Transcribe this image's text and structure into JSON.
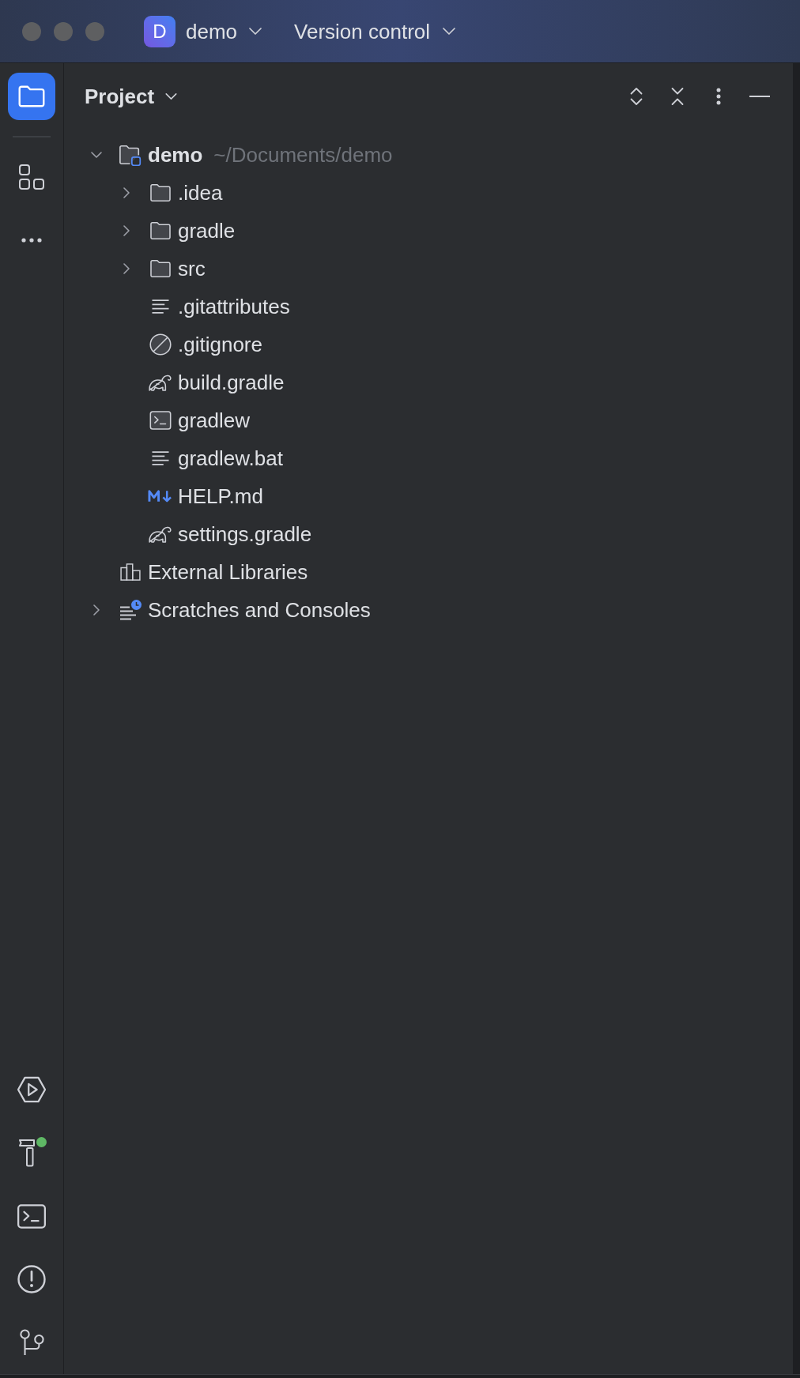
{
  "title_bar": {
    "project_badge": "D",
    "project": "demo",
    "vcs_menu": "Version control"
  },
  "tool_strip": {
    "top": [
      {
        "selected": true
      },
      {
        "selected": false
      }
    ],
    "bottom": [
      {
        "selected": false,
        "badge": false
      },
      {
        "selected": false,
        "badge": true
      },
      {
        "selected": false,
        "badge": false
      },
      {
        "selected": false,
        "badge": false
      },
      {
        "selected": false,
        "badge": false
      }
    ]
  },
  "panel": {
    "title": "Project"
  },
  "tree": [
    {
      "kind": "module",
      "name": "demo",
      "detail": "~/Documents/demo",
      "expanded": true,
      "children": [
        {
          "kind": "folder",
          "name": ".idea",
          "expanded": false
        },
        {
          "kind": "folder",
          "name": "gradle",
          "expanded": false
        },
        {
          "kind": "folder",
          "name": "src",
          "expanded": false
        },
        {
          "kind": "text",
          "name": ".gitattributes"
        },
        {
          "kind": "ignore",
          "name": ".gitignore"
        },
        {
          "kind": "gradle",
          "name": "build.gradle"
        },
        {
          "kind": "script",
          "name": "gradlew"
        },
        {
          "kind": "text",
          "name": "gradlew.bat"
        },
        {
          "kind": "markdown",
          "name": "HELP.md"
        },
        {
          "kind": "gradle",
          "name": "settings.gradle"
        }
      ]
    },
    {
      "kind": "libraries",
      "name": "External Libraries"
    },
    {
      "kind": "scratches",
      "name": "Scratches and Consoles",
      "expanded": false
    }
  ]
}
